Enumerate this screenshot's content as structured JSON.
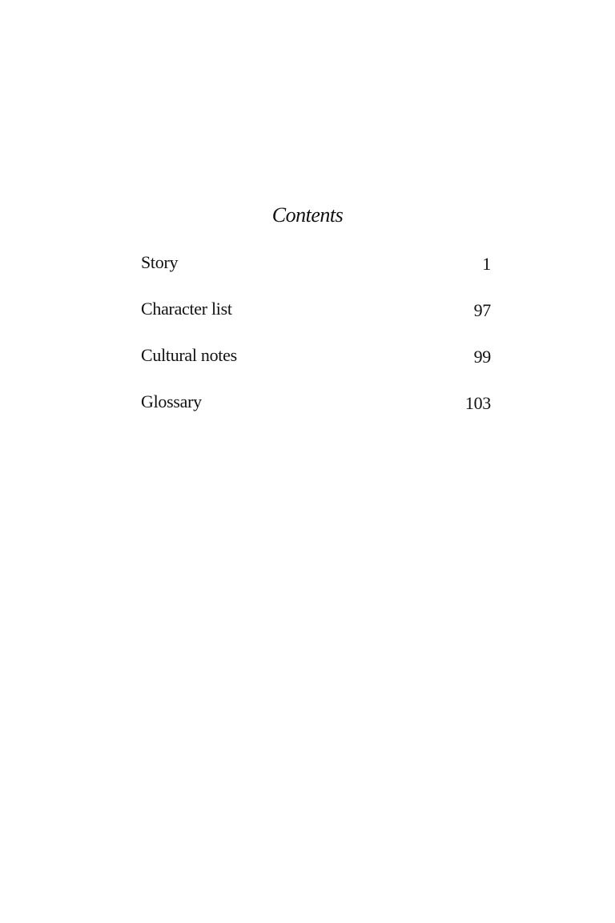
{
  "contents": {
    "title": "Contents",
    "entries": [
      {
        "label": "Story",
        "page": "1"
      },
      {
        "label": "Character list",
        "page": "97"
      },
      {
        "label": "Cultural notes",
        "page": "99"
      },
      {
        "label": "Glossary",
        "page": "103"
      }
    ]
  }
}
